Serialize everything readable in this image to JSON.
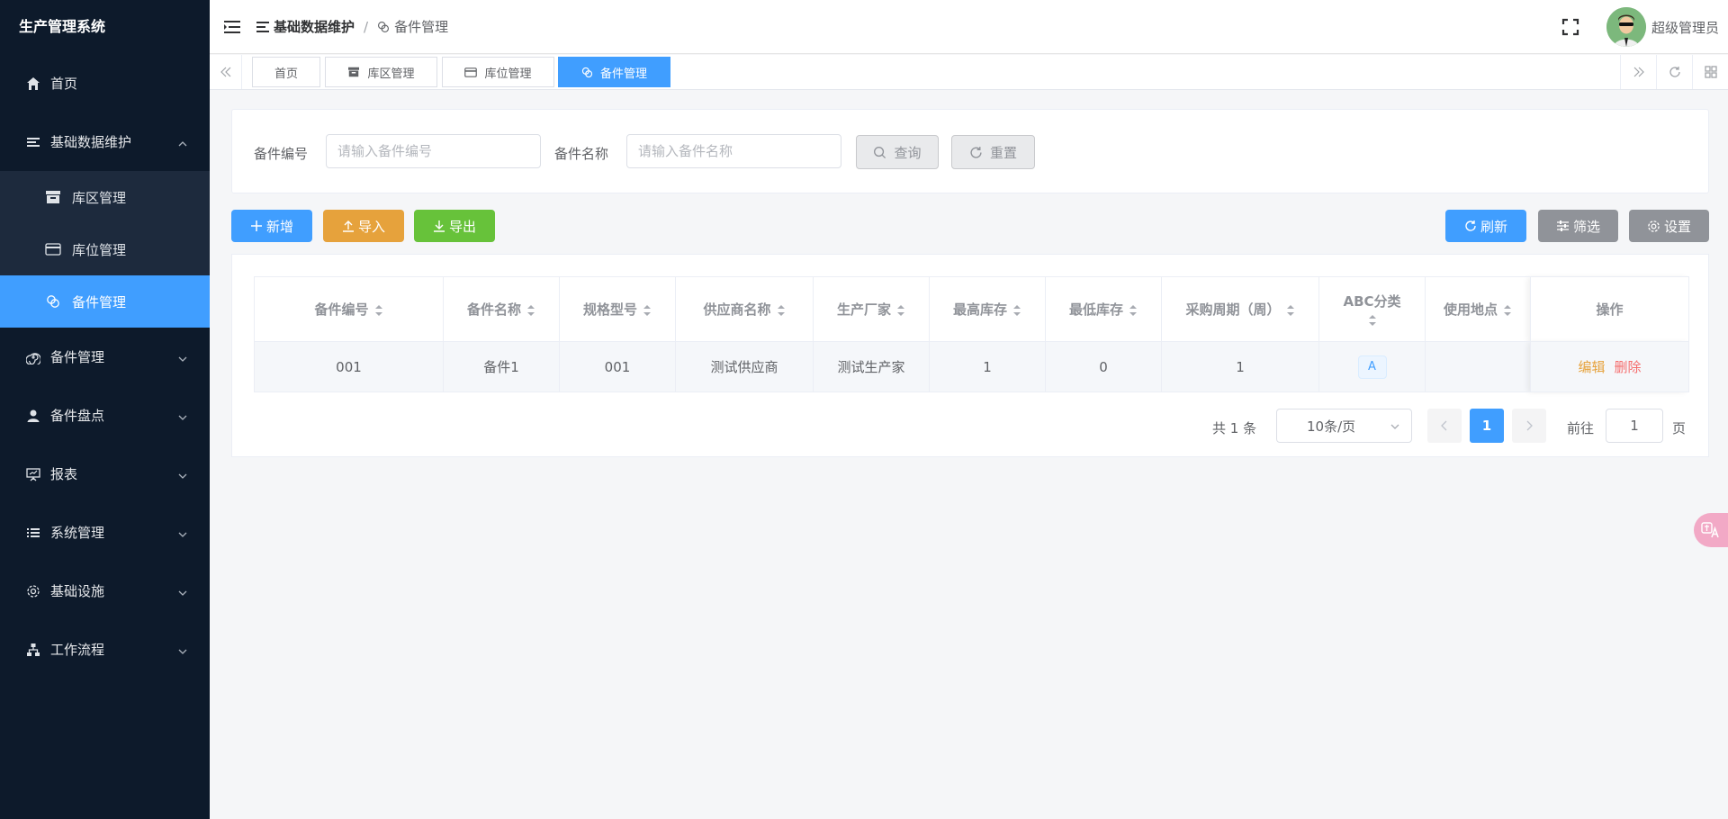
{
  "app": {
    "title": "生产管理系统"
  },
  "sidebar": {
    "items": [
      {
        "label": "首页",
        "icon": "home-icon"
      },
      {
        "label": "基础数据维护",
        "icon": "list-icon",
        "expanded": true,
        "children": [
          {
            "label": "库区管理",
            "icon": "archive-icon"
          },
          {
            "label": "库位管理",
            "icon": "card-icon"
          },
          {
            "label": "备件管理",
            "icon": "link-icon",
            "active": true
          }
        ]
      },
      {
        "label": "备件管理",
        "icon": "spiral-icon"
      },
      {
        "label": "备件盘点",
        "icon": "user-icon"
      },
      {
        "label": "报表",
        "icon": "presentation-icon"
      },
      {
        "label": "系统管理",
        "icon": "list-bullets-icon"
      },
      {
        "label": "基础设施",
        "icon": "gear-icon"
      },
      {
        "label": "工作流程",
        "icon": "org-chart-icon"
      }
    ]
  },
  "header": {
    "breadcrumb": {
      "parent": "基础数据维护",
      "current": "备件管理"
    },
    "username": "超级管理员"
  },
  "tags": [
    {
      "label": "首页"
    },
    {
      "label": "库区管理"
    },
    {
      "label": "库位管理"
    },
    {
      "label": "备件管理",
      "active": true
    }
  ],
  "search": {
    "code_label": "备件编号",
    "code_placeholder": "请输入备件编号",
    "name_label": "备件名称",
    "name_placeholder": "请输入备件名称",
    "query_label": "查询",
    "reset_label": "重置"
  },
  "toolbar": {
    "add_label": "新增",
    "import_label": "导入",
    "export_label": "导出",
    "refresh_label": "刷新",
    "filter_label": "筛选",
    "settings_label": "设置"
  },
  "table": {
    "columns": [
      "备件编号",
      "备件名称",
      "规格型号",
      "供应商名称",
      "生产厂家",
      "最高库存",
      "最低库存",
      "采购周期（周）",
      "ABC分类",
      "使用地点",
      "操作"
    ],
    "rows": [
      {
        "code": "001",
        "name": "备件1",
        "spec": "001",
        "supplier": "测试供应商",
        "maker": "测试生产家",
        "max": "1",
        "min": "0",
        "cycle": "1",
        "abc": "A",
        "place": "",
        "edit": "编辑",
        "del": "删除"
      }
    ]
  },
  "pagination": {
    "total_text": "共 1 条",
    "page_size": "10条/页",
    "current_page": "1",
    "goto_label": "前往",
    "goto_value": "1",
    "page_suffix": "页"
  },
  "colors": {
    "primary": "#409eff",
    "warning": "#e6a23c",
    "success": "#67c23a",
    "info": "#909399",
    "danger": "#f56c6c",
    "sidebar": "#0d1a2b"
  }
}
